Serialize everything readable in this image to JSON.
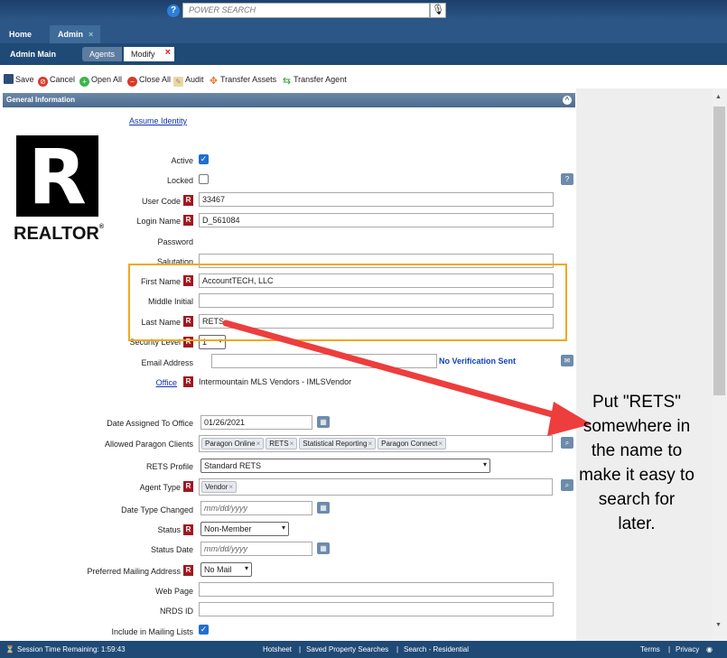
{
  "topbar": {
    "help_glyph": "?",
    "search_placeholder": "POWER SEARCH",
    "mic_icon": "microphone-icon"
  },
  "tabs": {
    "home": "Home",
    "admin": "Admin",
    "close_glyph": "×"
  },
  "subbar": {
    "admin_main": "Admin Main",
    "agents": "Agents",
    "modify": "Modify",
    "close_glyph": "×"
  },
  "toolbar": {
    "save": "Save",
    "cancel": "Cancel",
    "open_all": "Open All",
    "close_all": "Close All",
    "audit": "Audit",
    "transfer_assets": "Transfer Assets",
    "transfer_agent": "Transfer Agent"
  },
  "section": {
    "title": "General Information",
    "collapse_glyph": "^"
  },
  "assume_identity": "Assume Identity",
  "logo": {
    "letter": "R",
    "text": "REALTOR",
    "reg": "®"
  },
  "required_badge": "R",
  "form": {
    "active_label": "Active",
    "active_checked": true,
    "locked_label": "Locked",
    "locked_checked": false,
    "user_code_label": "User Code",
    "user_code": "33467",
    "login_name_label": "Login Name",
    "login_name": "D_561084",
    "password_label": "Password",
    "salutation_label": "Salutation",
    "salutation": "",
    "first_name_label": "First Name",
    "first_name": "AccountTECH, LLC",
    "middle_initial_label": "Middle Initial",
    "middle_initial": "",
    "last_name_label": "Last Name",
    "last_name": "RETS",
    "security_level_label": "Security Level",
    "security_level": "1",
    "email_label": "Email Address",
    "email": "",
    "no_verification": "No Verification Sent",
    "office_label": "Office",
    "office_value": "Intermountain MLS Vendors - IMLSVendor",
    "date_assigned_label": "Date Assigned To Office",
    "date_assigned": "01/26/2021",
    "allowed_clients_label": "Allowed Paragon Clients",
    "allowed_clients": [
      "Paragon Online",
      "RETS",
      "Statistical Reporting",
      "Paragon Connect"
    ],
    "rets_profile_label": "RETS Profile",
    "rets_profile": "Standard RETS",
    "agent_type_label": "Agent Type",
    "agent_type": [
      "Vendor"
    ],
    "date_type_changed_label": "Date Type Changed",
    "date_placeholder": "mm/dd/yyyy",
    "status_label": "Status",
    "status": "Non-Member",
    "status_date_label": "Status Date",
    "preferred_mailing_label": "Preferred Mailing Address",
    "preferred_mailing": "No Mail",
    "web_page_label": "Web Page",
    "web_page": "",
    "nrds_label": "NRDS ID",
    "nrds": "",
    "mailing_lists_label": "Include in Mailing Lists",
    "mailing_lists_checked": true
  },
  "callout": "Put \"RETS\" somewhere in the name to make it easy to search for later.",
  "footer": {
    "session": "Session Time Remaining: 1:59:43",
    "hotsheet": "Hotsheet",
    "saved_searches": "Saved Property Searches",
    "search_residential": "Search - Residential",
    "sep": "|",
    "terms": "Terms",
    "privacy": "Privacy"
  },
  "colors": {
    "nav_dark": "#1f4a76",
    "required": "#a01820",
    "highlight": "#f0a81c",
    "arrow": "#ee3d3d"
  }
}
